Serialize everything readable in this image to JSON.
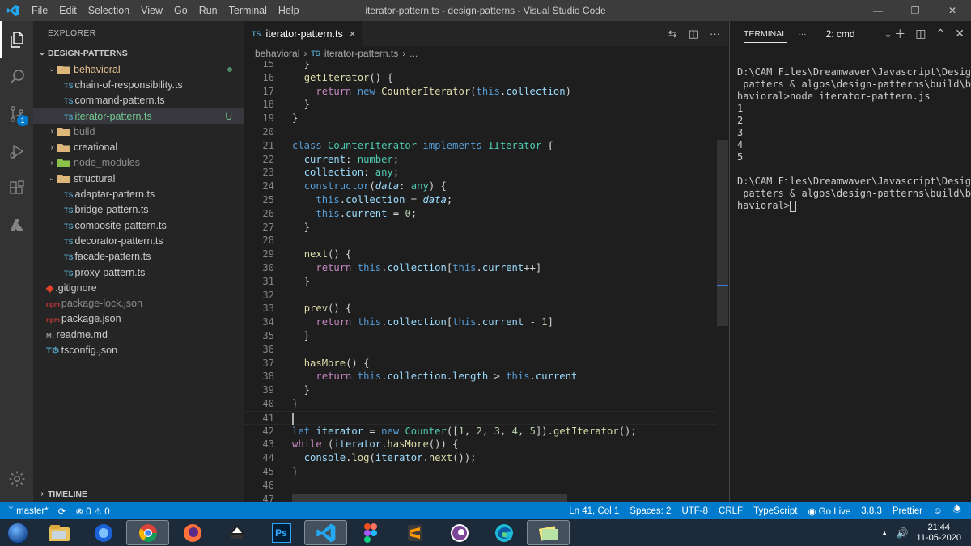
{
  "window": {
    "title": "iterator-pattern.ts - design-patterns - Visual Studio Code",
    "menu": [
      "File",
      "Edit",
      "Selection",
      "View",
      "Go",
      "Run",
      "Terminal",
      "Help"
    ]
  },
  "activity_bar": {
    "items": [
      "explorer-icon",
      "search-icon",
      "source-control-icon",
      "run-debug-icon",
      "extensions-icon",
      "azure-icon"
    ],
    "scm_badge": "1"
  },
  "sidebar": {
    "header": "EXPLORER",
    "section": "DESIGN-PATTERNS",
    "timeline": "TIMELINE",
    "tree": [
      {
        "label": "behavioral",
        "type": "folder",
        "open": true,
        "depth": 1,
        "status": "mod"
      },
      {
        "label": "chain-of-responsibility.ts",
        "type": "ts",
        "depth": 2
      },
      {
        "label": "command-pattern.ts",
        "type": "ts",
        "depth": 2
      },
      {
        "label": "iterator-pattern.ts",
        "type": "ts",
        "depth": 2,
        "selected": true,
        "status": "untracked",
        "mark": "U"
      },
      {
        "label": "build",
        "type": "folder",
        "open": false,
        "depth": 1,
        "status": "dim"
      },
      {
        "label": "creational",
        "type": "folder",
        "open": false,
        "depth": 1
      },
      {
        "label": "node_modules",
        "type": "folder-node",
        "open": false,
        "depth": 1,
        "status": "dim"
      },
      {
        "label": "structural",
        "type": "folder",
        "open": true,
        "depth": 1
      },
      {
        "label": "adaptar-pattern.ts",
        "type": "ts",
        "depth": 2
      },
      {
        "label": "bridge-pattern.ts",
        "type": "ts",
        "depth": 2
      },
      {
        "label": "composite-pattern.ts",
        "type": "ts",
        "depth": 2
      },
      {
        "label": "decorator-pattern.ts",
        "type": "ts",
        "depth": 2
      },
      {
        "label": "facade-pattern.ts",
        "type": "ts",
        "depth": 2
      },
      {
        "label": "proxy-pattern.ts",
        "type": "ts",
        "depth": 2
      },
      {
        "label": ".gitignore",
        "type": "git",
        "depth": 1
      },
      {
        "label": "package-lock.json",
        "type": "npm",
        "depth": 1,
        "status": "dim"
      },
      {
        "label": "package.json",
        "type": "npm",
        "depth": 1
      },
      {
        "label": "readme.md",
        "type": "md",
        "depth": 1
      },
      {
        "label": "tsconfig.json",
        "type": "tsconfig",
        "depth": 1
      }
    ]
  },
  "editor": {
    "tab_label": "iterator-pattern.ts",
    "tab_icon": "TS",
    "breadcrumb": [
      "behavioral",
      "iterator-pattern.ts",
      "..."
    ],
    "current_line": 41,
    "lines": [
      {
        "n": 15,
        "tokens": [
          [
            "txt",
            "  }"
          ]
        ]
      },
      {
        "n": 16,
        "tokens": [
          [
            "txt",
            "  "
          ],
          [
            "fn",
            "getIterator"
          ],
          [
            "txt",
            "() {"
          ]
        ]
      },
      {
        "n": 17,
        "tokens": [
          [
            "txt",
            "    "
          ],
          [
            "kw2",
            "return"
          ],
          [
            "txt",
            " "
          ],
          [
            "kw",
            "new"
          ],
          [
            "txt",
            " "
          ],
          [
            "fn",
            "CounterIterator"
          ],
          [
            "txt",
            "("
          ],
          [
            "kw",
            "this"
          ],
          [
            "txt",
            "."
          ],
          [
            "prop",
            "collection"
          ],
          [
            "txt",
            ")"
          ]
        ]
      },
      {
        "n": 18,
        "tokens": [
          [
            "txt",
            "  }"
          ]
        ]
      },
      {
        "n": 19,
        "tokens": [
          [
            "txt",
            "}"
          ]
        ]
      },
      {
        "n": 20,
        "tokens": []
      },
      {
        "n": 21,
        "tokens": [
          [
            "kw",
            "class"
          ],
          [
            "txt",
            " "
          ],
          [
            "cls",
            "CounterIterator"
          ],
          [
            "txt",
            " "
          ],
          [
            "kw",
            "implements"
          ],
          [
            "txt",
            " "
          ],
          [
            "cls",
            "IIterator"
          ],
          [
            "txt",
            " {"
          ]
        ]
      },
      {
        "n": 22,
        "tokens": [
          [
            "txt",
            "  "
          ],
          [
            "prop",
            "current"
          ],
          [
            "txt",
            ": "
          ],
          [
            "cls",
            "number"
          ],
          [
            "txt",
            ";"
          ]
        ]
      },
      {
        "n": 23,
        "tokens": [
          [
            "txt",
            "  "
          ],
          [
            "prop",
            "collection"
          ],
          [
            "txt",
            ": "
          ],
          [
            "cls",
            "any"
          ],
          [
            "txt",
            ";"
          ]
        ]
      },
      {
        "n": 24,
        "tokens": [
          [
            "txt",
            "  "
          ],
          [
            "kw",
            "constructor"
          ],
          [
            "txt",
            "("
          ],
          [
            "par",
            "data"
          ],
          [
            "txt",
            ": "
          ],
          [
            "cls",
            "any"
          ],
          [
            "txt",
            ") {"
          ]
        ]
      },
      {
        "n": 25,
        "tokens": [
          [
            "txt",
            "    "
          ],
          [
            "kw",
            "this"
          ],
          [
            "txt",
            "."
          ],
          [
            "prop",
            "collection"
          ],
          [
            "txt",
            " = "
          ],
          [
            "par",
            "data"
          ],
          [
            "txt",
            ";"
          ]
        ]
      },
      {
        "n": 26,
        "tokens": [
          [
            "txt",
            "    "
          ],
          [
            "kw",
            "this"
          ],
          [
            "txt",
            "."
          ],
          [
            "prop",
            "current"
          ],
          [
            "txt",
            " = "
          ],
          [
            "num",
            "0"
          ],
          [
            "txt",
            ";"
          ]
        ]
      },
      {
        "n": 27,
        "tokens": [
          [
            "txt",
            "  }"
          ]
        ]
      },
      {
        "n": 28,
        "tokens": []
      },
      {
        "n": 29,
        "tokens": [
          [
            "txt",
            "  "
          ],
          [
            "fn",
            "next"
          ],
          [
            "txt",
            "() {"
          ]
        ]
      },
      {
        "n": 30,
        "tokens": [
          [
            "txt",
            "    "
          ],
          [
            "kw2",
            "return"
          ],
          [
            "txt",
            " "
          ],
          [
            "kw",
            "this"
          ],
          [
            "txt",
            "."
          ],
          [
            "prop",
            "collection"
          ],
          [
            "txt",
            "["
          ],
          [
            "kw",
            "this"
          ],
          [
            "txt",
            "."
          ],
          [
            "prop",
            "current"
          ],
          [
            "txt",
            "++]"
          ]
        ]
      },
      {
        "n": 31,
        "tokens": [
          [
            "txt",
            "  }"
          ]
        ]
      },
      {
        "n": 32,
        "tokens": []
      },
      {
        "n": 33,
        "tokens": [
          [
            "txt",
            "  "
          ],
          [
            "fn",
            "prev"
          ],
          [
            "txt",
            "() {"
          ]
        ]
      },
      {
        "n": 34,
        "tokens": [
          [
            "txt",
            "    "
          ],
          [
            "kw2",
            "return"
          ],
          [
            "txt",
            " "
          ],
          [
            "kw",
            "this"
          ],
          [
            "txt",
            "."
          ],
          [
            "prop",
            "collection"
          ],
          [
            "txt",
            "["
          ],
          [
            "kw",
            "this"
          ],
          [
            "txt",
            "."
          ],
          [
            "prop",
            "current"
          ],
          [
            "txt",
            " - "
          ],
          [
            "num",
            "1"
          ],
          [
            "txt",
            "]"
          ]
        ]
      },
      {
        "n": 35,
        "tokens": [
          [
            "txt",
            "  }"
          ]
        ]
      },
      {
        "n": 36,
        "tokens": []
      },
      {
        "n": 37,
        "tokens": [
          [
            "txt",
            "  "
          ],
          [
            "fn",
            "hasMore"
          ],
          [
            "txt",
            "() {"
          ]
        ]
      },
      {
        "n": 38,
        "tokens": [
          [
            "txt",
            "    "
          ],
          [
            "kw2",
            "return"
          ],
          [
            "txt",
            " "
          ],
          [
            "kw",
            "this"
          ],
          [
            "txt",
            "."
          ],
          [
            "prop",
            "collection"
          ],
          [
            "txt",
            "."
          ],
          [
            "prop",
            "length"
          ],
          [
            "txt",
            " > "
          ],
          [
            "kw",
            "this"
          ],
          [
            "txt",
            "."
          ],
          [
            "prop",
            "current"
          ]
        ]
      },
      {
        "n": 39,
        "tokens": [
          [
            "txt",
            "  }"
          ]
        ]
      },
      {
        "n": 40,
        "tokens": [
          [
            "txt",
            "}"
          ]
        ]
      },
      {
        "n": 41,
        "tokens": []
      },
      {
        "n": 42,
        "tokens": [
          [
            "kw",
            "let"
          ],
          [
            "txt",
            " "
          ],
          [
            "prop",
            "iterator"
          ],
          [
            "txt",
            " = "
          ],
          [
            "kw",
            "new"
          ],
          [
            "txt",
            " "
          ],
          [
            "cls",
            "Counter"
          ],
          [
            "txt",
            "(["
          ],
          [
            "num",
            "1"
          ],
          [
            "txt",
            ", "
          ],
          [
            "num",
            "2"
          ],
          [
            "txt",
            ", "
          ],
          [
            "num",
            "3"
          ],
          [
            "txt",
            ", "
          ],
          [
            "num",
            "4"
          ],
          [
            "txt",
            ", "
          ],
          [
            "num",
            "5"
          ],
          [
            "txt",
            "])."
          ],
          [
            "fn",
            "getIterator"
          ],
          [
            "txt",
            "();"
          ]
        ]
      },
      {
        "n": 43,
        "tokens": [
          [
            "kw2",
            "while"
          ],
          [
            "txt",
            " ("
          ],
          [
            "prop",
            "iterator"
          ],
          [
            "txt",
            "."
          ],
          [
            "fn",
            "hasMore"
          ],
          [
            "txt",
            "()) {"
          ]
        ]
      },
      {
        "n": 44,
        "tokens": [
          [
            "txt",
            "  "
          ],
          [
            "prop",
            "console"
          ],
          [
            "txt",
            "."
          ],
          [
            "fn",
            "log"
          ],
          [
            "txt",
            "("
          ],
          [
            "prop",
            "iterator"
          ],
          [
            "txt",
            "."
          ],
          [
            "fn",
            "next"
          ],
          [
            "txt",
            "());"
          ]
        ]
      },
      {
        "n": 45,
        "tokens": [
          [
            "txt",
            "}"
          ]
        ]
      },
      {
        "n": 46,
        "tokens": []
      },
      {
        "n": 47,
        "tokens": []
      }
    ]
  },
  "panel": {
    "tab_label": "TERMINAL",
    "more": "···",
    "terminal_select": "2: cmd",
    "lines": [
      "D:\\CAM Files\\Dreamwaver\\Javascript\\Design",
      " patters & algos\\design-patterns\\build\\be",
      "havioral>node iterator-pattern.js",
      "1",
      "2",
      "3",
      "4",
      "5",
      "",
      "D:\\CAM Files\\Dreamwaver\\Javascript\\Design",
      " patters & algos\\design-patterns\\build\\be",
      "havioral>"
    ]
  },
  "statusbar": {
    "branch": "master*",
    "problems": "⊗ 0 ⚠ 0",
    "position": "Ln 41, Col 1",
    "spaces": "Spaces: 2",
    "encoding": "UTF-8",
    "eol": "CRLF",
    "language": "TypeScript",
    "golive": "Go Live",
    "version": "3.8.3",
    "prettier": "Prettier"
  },
  "taskbar": {
    "apps": [
      "file-explorer-icon",
      "firefox-dev-icon",
      "chrome-icon",
      "firefox-icon",
      "inkscape-icon",
      "photoshop-icon",
      "vscode-icon",
      "figma-icon",
      "sublime-icon",
      "tor-icon",
      "edge-icon",
      "notes-icon"
    ],
    "active_app": "vscode-icon",
    "ps_label": "Ps",
    "time": "21:44",
    "date": "11-05-2020",
    "colors": {
      "chrome_red": "#db4437",
      "firefox_orange": "#ff7139",
      "ps_blue": "#31a8ff",
      "vscode_blue": "#23a9f2",
      "sublime_orange": "#ff9800",
      "edge_teal": "#1ebbd7"
    }
  }
}
